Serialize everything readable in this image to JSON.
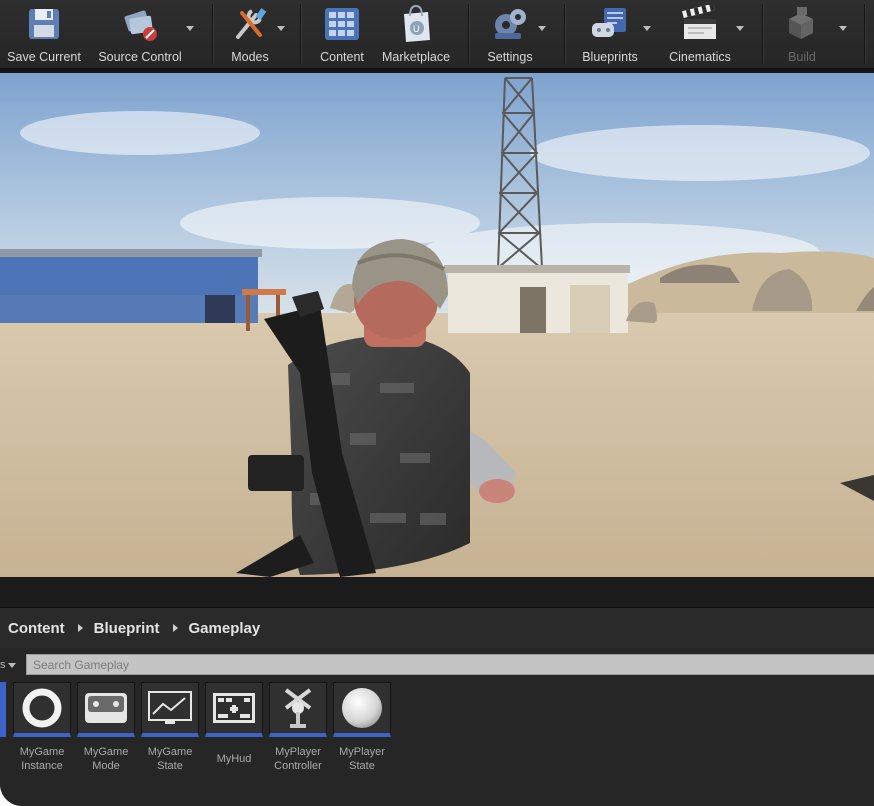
{
  "toolbar": {
    "buttons": [
      {
        "label": "Save Current",
        "icon": "floppy-disk-icon"
      },
      {
        "label": "Source Control",
        "icon": "source-control-icon"
      },
      {
        "label": "Modes",
        "icon": "modes-tools-icon"
      },
      {
        "label": "Content",
        "icon": "content-grid-icon"
      },
      {
        "label": "Marketplace",
        "icon": "marketplace-bag-icon"
      },
      {
        "label": "Settings",
        "icon": "settings-gears-icon"
      },
      {
        "label": "Blueprints",
        "icon": "blueprints-icon"
      },
      {
        "label": "Cinematics",
        "icon": "clapperboard-icon"
      },
      {
        "label": "Build",
        "icon": "build-blocks-icon",
        "disabled": true
      }
    ]
  },
  "viewport": {
    "scene": "third-person soldier in desert level with radio tower and buildings"
  },
  "content_browser": {
    "breadcrumb": [
      "Content",
      "Blueprint",
      "Gameplay"
    ],
    "search_placeholder": "Search Gameplay",
    "accent_color": "#3d63c8",
    "assets": [
      {
        "label": "MyGame\nInstance",
        "icon": "ring-icon"
      },
      {
        "label": "MyGame\nMode",
        "icon": "gamepad-icon"
      },
      {
        "label": "MyGame\nState",
        "icon": "graph-monitor-icon"
      },
      {
        "label": "MyHud",
        "icon": "hud-screen-icon"
      },
      {
        "label": "MyPlayer\nController",
        "icon": "player-controller-icon"
      },
      {
        "label": "MyPlayer\nState",
        "icon": "sphere-icon"
      }
    ]
  }
}
